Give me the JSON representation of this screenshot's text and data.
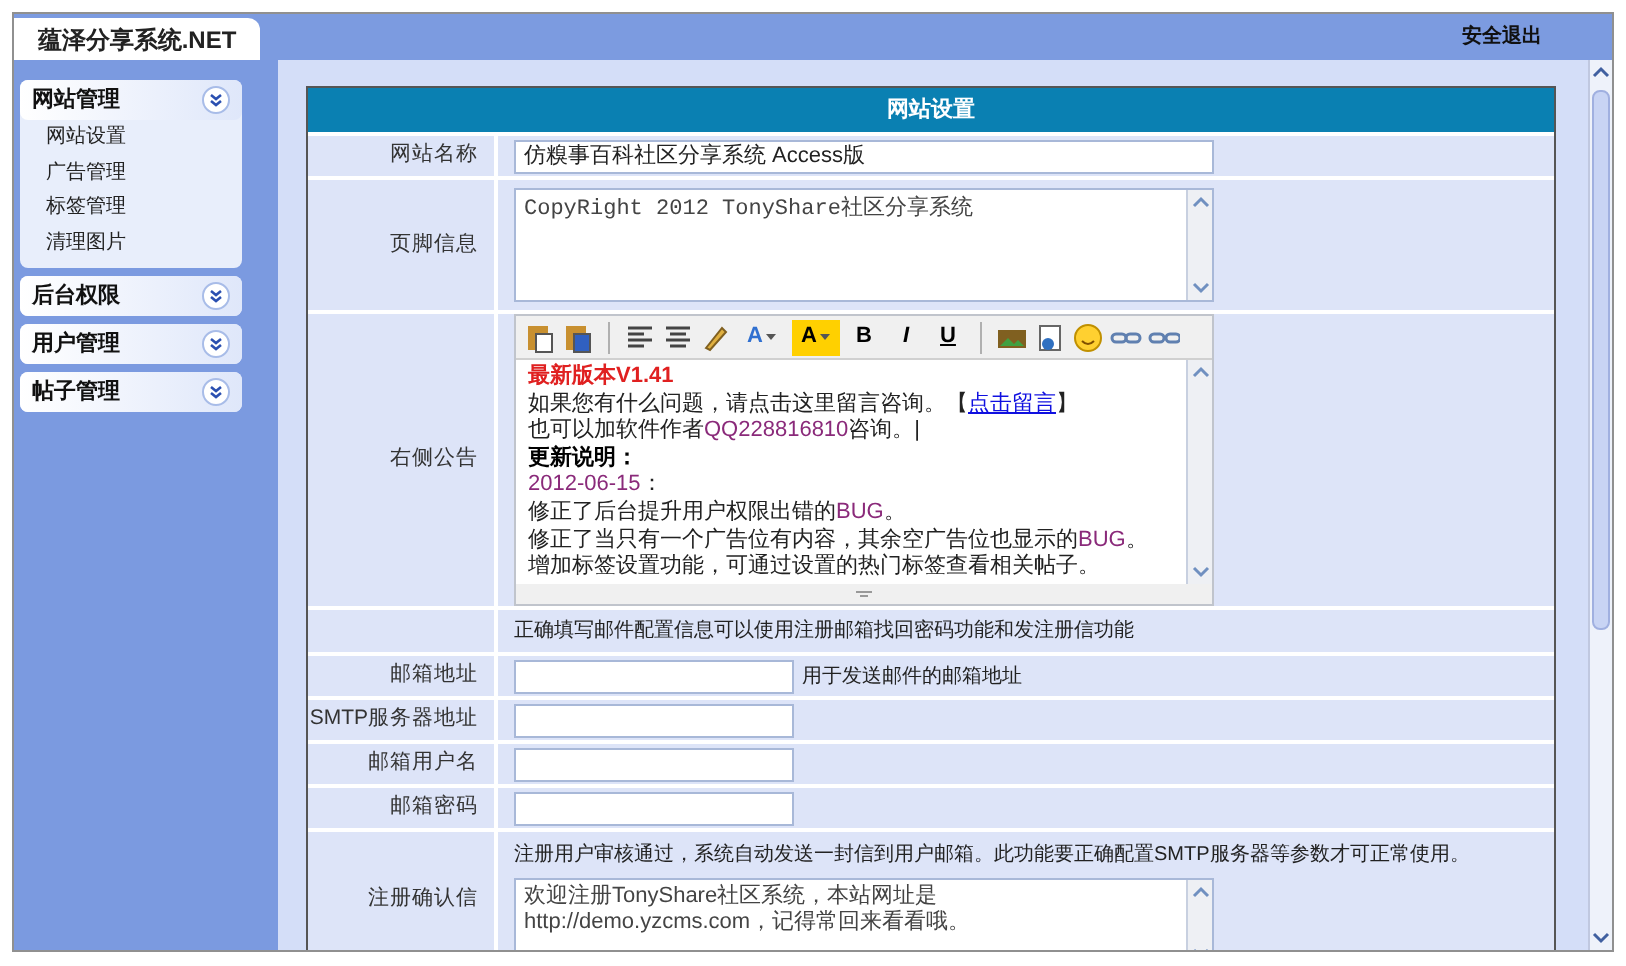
{
  "brand": "蕴泽分享系统.NET",
  "logout": "安全退出",
  "sidebar": [
    {
      "title": "网站管理",
      "expanded": true,
      "items": [
        "网站设置",
        "广告管理",
        "标签管理",
        "清理图片"
      ]
    },
    {
      "title": "后台权限",
      "expanded": false
    },
    {
      "title": "用户管理",
      "expanded": false
    },
    {
      "title": "帖子管理",
      "expanded": false
    }
  ],
  "form": {
    "title": "网站设置",
    "rows": [
      {
        "kind": "text",
        "label": "网站名称",
        "value": "仿糗事百科社区分享系统 Access版"
      },
      {
        "kind": "textarea",
        "label": "页脚信息",
        "value": "CopyRight 2012 TonyShare社区分享系统"
      },
      {
        "kind": "editor",
        "label": "右侧公告",
        "toolbar": [
          {
            "kind": "paste"
          },
          {
            "kind": "paste-word"
          },
          {
            "kind": "sep"
          },
          {
            "kind": "align-left"
          },
          {
            "kind": "align-center"
          },
          {
            "kind": "brush"
          },
          {
            "kind": "font-color",
            "text": "A"
          },
          {
            "kind": "bg-color",
            "text": "A"
          },
          {
            "kind": "bold",
            "text": "B"
          },
          {
            "kind": "italic",
            "text": "I"
          },
          {
            "kind": "underline",
            "text": "U"
          },
          {
            "kind": "sep"
          },
          {
            "kind": "image"
          },
          {
            "kind": "flash"
          },
          {
            "kind": "smiley"
          },
          {
            "kind": "link"
          },
          {
            "kind": "unlink"
          }
        ],
        "lines": [
          [
            {
              "kind": "title",
              "text": "最新版本V1.41"
            }
          ],
          [
            {
              "kind": "plain",
              "text": "如果您有什么问题，请点击这里留言咨询。【"
            },
            {
              "kind": "link",
              "text": "点击留言"
            },
            {
              "kind": "plain",
              "text": "】"
            }
          ],
          [
            {
              "kind": "plain",
              "text": "也可以加软件作者"
            },
            {
              "kind": "accent",
              "text": "QQ228816810"
            },
            {
              "kind": "plain",
              "text": "咨询。|"
            }
          ],
          [
            {
              "kind": "bold",
              "text": "更新说明："
            }
          ],
          [
            {
              "kind": "accent",
              "text": "2012-06-15"
            },
            {
              "kind": "plain",
              "text": "："
            }
          ],
          [
            {
              "kind": "plain",
              "text": "修正了后台提升用户权限出错的"
            },
            {
              "kind": "accent",
              "text": "BUG"
            },
            {
              "kind": "plain",
              "text": "。"
            }
          ],
          [
            {
              "kind": "plain",
              "text": "修正了当只有一个广告位有内容，其余空广告位也显示的"
            },
            {
              "kind": "accent",
              "text": "BUG"
            },
            {
              "kind": "plain",
              "text": "。"
            }
          ],
          [
            {
              "kind": "plain",
              "text": "增加标签设置功能，可通过设置的热门标签查看相关帖子。"
            }
          ]
        ]
      },
      {
        "kind": "note",
        "text": "正确填写邮件配置信息可以使用注册邮箱找回密码功能和发注册信功能"
      },
      {
        "kind": "input",
        "label": "邮箱地址",
        "hint": "用于发送邮件的邮箱地址"
      },
      {
        "kind": "input",
        "label": "SMTP服务器地址"
      },
      {
        "kind": "input",
        "label": "邮箱用户名"
      },
      {
        "kind": "input",
        "label": "邮箱密码"
      },
      {
        "kind": "note-textarea",
        "label": "注册确认信",
        "note": "注册用户审核通过，系统自动发送一封信到用户邮箱。此功能要正确配置SMTP服务器等参数才可正常使用。",
        "value": "欢迎注册TonyShare社区系统，本站网址是http://demo.yzcms.com，记得常回来看看哦。"
      }
    ]
  }
}
